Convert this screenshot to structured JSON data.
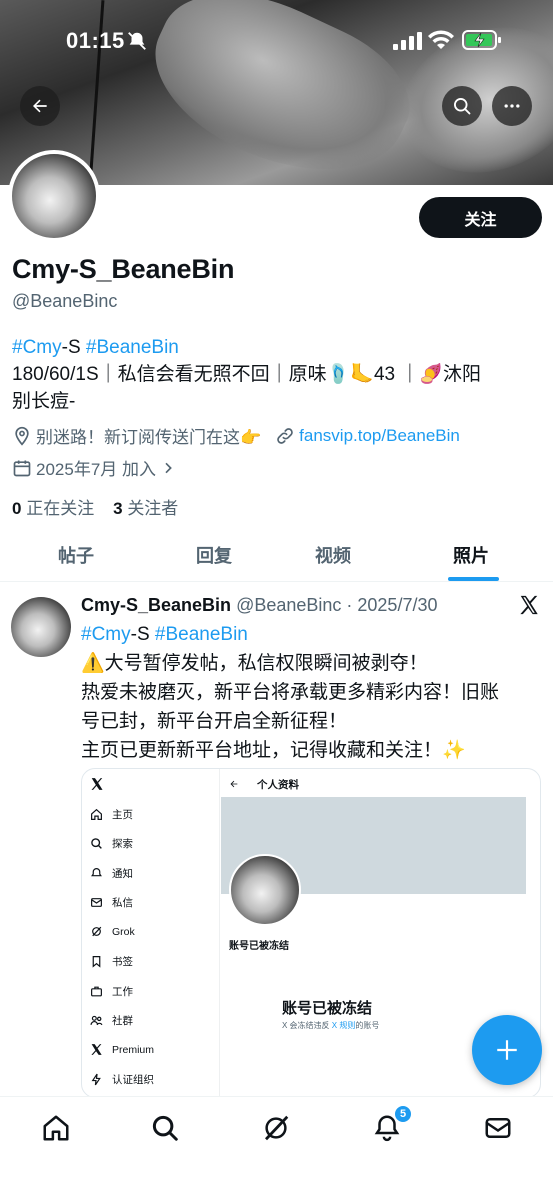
{
  "status_bar": {
    "time": "01:15"
  },
  "profile": {
    "follow_label": "关注",
    "name": "Cmy-S_BeaneBin",
    "handle": "@BeaneBinc",
    "bio_hashtag_1": "#Cmy",
    "bio_dash_s": "-S ",
    "bio_hashtag_2": "#BeaneBin",
    "bio_line_2": "180/60/1S｜私信会看无照不回｜原味🩴🦶43 ｜🍠沐阳",
    "bio_line_3": "别长痘-",
    "location": "别迷路！新订阅传送门在这👉",
    "website": "fansvip.top/BeaneBin",
    "joined": "2025年7月 加入",
    "following_count": "0",
    "following_label": "正在关注",
    "followers_count": "3",
    "followers_label": "关注者"
  },
  "tabs": [
    {
      "label": "帖子"
    },
    {
      "label": "回复"
    },
    {
      "label": "视频"
    },
    {
      "label": "照片",
      "active": true
    }
  ],
  "post": {
    "name": "Cmy-S_BeaneBin",
    "handle_date": "@BeaneBinc · 2025/7/30",
    "hashtag_1": "#Cmy",
    "dash_s": "-S ",
    "hashtag_2": "#BeaneBin",
    "line_1": "⚠️大号暂停发帖，私信权限瞬间被剥夺！",
    "line_2": "热爱未被磨灭，新平台将承载更多精彩内容！旧账",
    "line_3": "号已封，新平台开启全新征程！",
    "line_4": "主页已更新新平台地址，记得收藏和关注！✨"
  },
  "embed": {
    "header": "个人资料",
    "sidebar": [
      "主页",
      "探索",
      "通知",
      "私信",
      "Grok",
      "书签",
      "工作",
      "社群",
      "Premium",
      "认证组织"
    ],
    "frozen_small": "账号已被冻结",
    "frozen_big": "账号已被冻结",
    "frozen_note_prefix": "X 会冻结违反 ",
    "frozen_note_link": "X 规则",
    "frozen_note_suffix": "的账号"
  },
  "nav": {
    "notification_badge": "5"
  },
  "colors": {
    "accent": "#1d9bf0",
    "text": "#0f1419",
    "secondary": "#536471"
  }
}
